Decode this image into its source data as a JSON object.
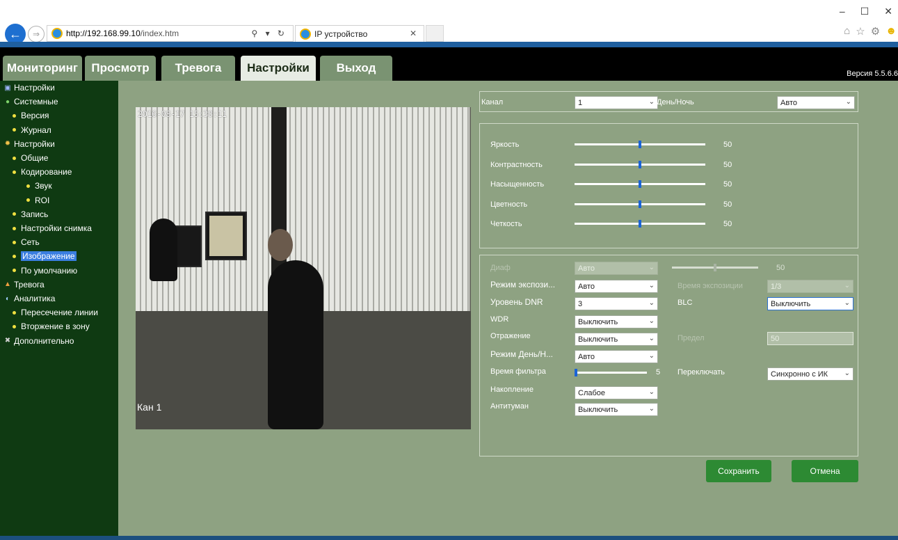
{
  "browser": {
    "url_host": "http://192.168.99.10",
    "url_path": "/index.htm",
    "tab_title": "IP устройство"
  },
  "menu": {
    "tabs": [
      "Мониторинг",
      "Просмотр",
      "Тревога",
      "Настройки",
      "Выход"
    ],
    "active": "Настройки",
    "version": "Версия 5.5.6.6"
  },
  "sidebar": {
    "items": [
      {
        "label": "Настройки",
        "level": 0,
        "icon": "monitor-icon"
      },
      {
        "label": "Системные",
        "level": 0,
        "icon": "info-icon"
      },
      {
        "label": "Версия",
        "level": 1
      },
      {
        "label": "Журнал",
        "level": 1
      },
      {
        "label": "Настройки",
        "level": 0,
        "icon": "gear-icon"
      },
      {
        "label": "Общие",
        "level": 1
      },
      {
        "label": "Кодирование",
        "level": 1
      },
      {
        "label": "Звук",
        "level": 2
      },
      {
        "label": "ROI",
        "level": 2
      },
      {
        "label": "Запись",
        "level": 1
      },
      {
        "label": "Настройки снимка",
        "level": 1
      },
      {
        "label": "Сеть",
        "level": 1
      },
      {
        "label": "Изображение",
        "level": 1,
        "selected": true
      },
      {
        "label": "По умолчанию",
        "level": 1
      },
      {
        "label": "Тревога",
        "level": 0,
        "icon": "alarm-icon"
      },
      {
        "label": "Аналитика",
        "level": 0,
        "icon": "analytics-icon"
      },
      {
        "label": "Пересечение линии",
        "level": 1
      },
      {
        "label": "Вторжение в зону",
        "level": 1
      },
      {
        "label": "Дополнительно",
        "level": 0,
        "icon": "tools-icon"
      }
    ]
  },
  "video": {
    "timestamp": "2016-08-17 15:38:11",
    "channel_label": "Кан 1"
  },
  "top_panel": {
    "channel_label": "Канал",
    "channel_value": "1",
    "daynight_label": "День/Ночь",
    "daynight_value": "Авто"
  },
  "sliders": [
    {
      "label": "Яркость",
      "value": 50
    },
    {
      "label": "Контрастность",
      "value": 50
    },
    {
      "label": "Насыщенность",
      "value": 50
    },
    {
      "label": "Цветность",
      "value": 50
    },
    {
      "label": "Четкость",
      "value": 50
    }
  ],
  "advanced": {
    "iris_label": "Диаф",
    "iris_value": "Авто",
    "iris_slider_value": "50",
    "exposure_mode_label": "Режим экспози...",
    "exposure_mode_value": "Авто",
    "exposure_time_label": "Время экспозиции",
    "exposure_time_value": "1/3",
    "dnr_label": "Уровень DNR",
    "dnr_value": "3",
    "blc_label": "BLC",
    "blc_value": "Выключить",
    "wdr_label": "WDR",
    "wdr_value": "Выключить",
    "mirror_label": "Отражение",
    "mirror_value": "Выключить",
    "limit_label": "Предел",
    "limit_value": "50",
    "daynight_mode_label": "Режим День/Н...",
    "daynight_mode_value": "Авто",
    "filter_time_label": "Время фильтра",
    "filter_time_value": "5",
    "switch_label": "Переключать",
    "switch_value": "Синхронно с ИК",
    "accumulation_label": "Накопление",
    "accumulation_value": "Слабое",
    "antifog_label": "Антитуман",
    "antifog_value": "Выключить"
  },
  "buttons": {
    "save": "Сохранить",
    "cancel": "Отмена"
  }
}
